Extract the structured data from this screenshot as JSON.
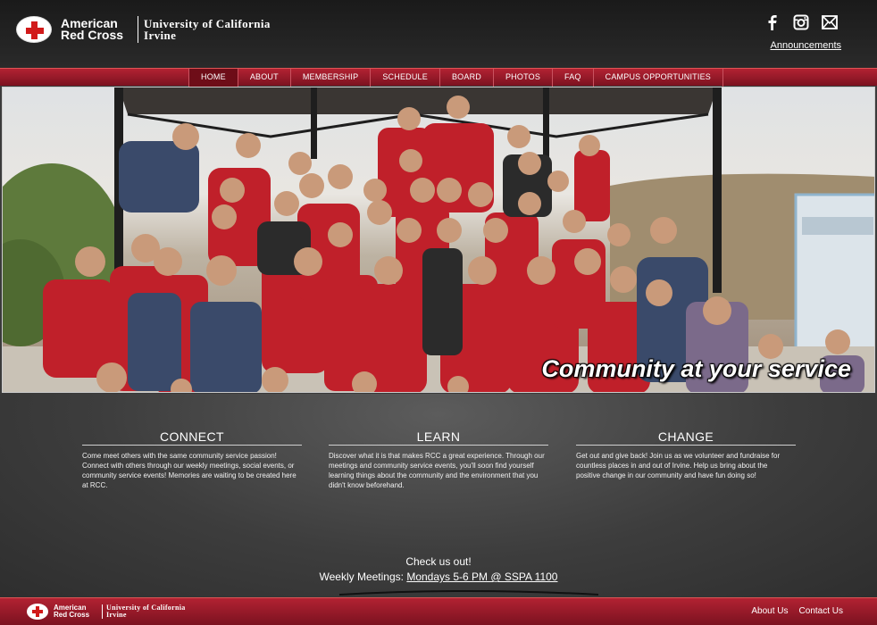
{
  "header": {
    "org_line1": "American",
    "org_line2": "Red Cross",
    "univ_line1": "University of California",
    "univ_line2": "Irvine",
    "social_icons": [
      "facebook-icon",
      "instagram-icon",
      "email-icon"
    ],
    "announcements_label": "Announcements"
  },
  "nav": {
    "items": [
      {
        "label": "HOME",
        "active": true
      },
      {
        "label": "ABOUT"
      },
      {
        "label": "MEMBERSHIP"
      },
      {
        "label": "SCHEDULE"
      },
      {
        "label": "BOARD"
      },
      {
        "label": "PHOTOS"
      },
      {
        "label": "FAQ"
      },
      {
        "label": "CAMPUS OPPORTUNITIES"
      }
    ]
  },
  "hero": {
    "tagline": "Community at your service"
  },
  "columns": [
    {
      "title": "CONNECT",
      "body": "Come meet others with the same community service passion! Connect with others through our weekly meetings, social events, or community service events! Memories are waiting to be created here at RCC."
    },
    {
      "title": "LEARN",
      "body": "Discover what it is that makes RCC a great experience. Through our meetings and community service events, you'll soon find yourself learning things about the community and the environment that you didn't know beforehand."
    },
    {
      "title": "CHANGE",
      "body": "Get out and give back! Join us as we volunteer and fundraise for countless places in and out of Irvine. Help us bring about the positive change in our community and have fun doing so!"
    }
  ],
  "cta": {
    "line1": "Check us out!",
    "line2_prefix": "Weekly Meetings: ",
    "line2_link": "Mondays 5-6 PM @ SSPA 1100"
  },
  "footer": {
    "org_line1": "American",
    "org_line2": "Red Cross",
    "univ_line1": "University of California",
    "univ_line2": "Irvine",
    "links": [
      "About Us",
      "Contact Us"
    ]
  },
  "colors": {
    "brand_red": "#b22232",
    "cross_red": "#d11a1a",
    "header_bg": "#1a1a1a",
    "content_bg": "#3d3d3d"
  }
}
